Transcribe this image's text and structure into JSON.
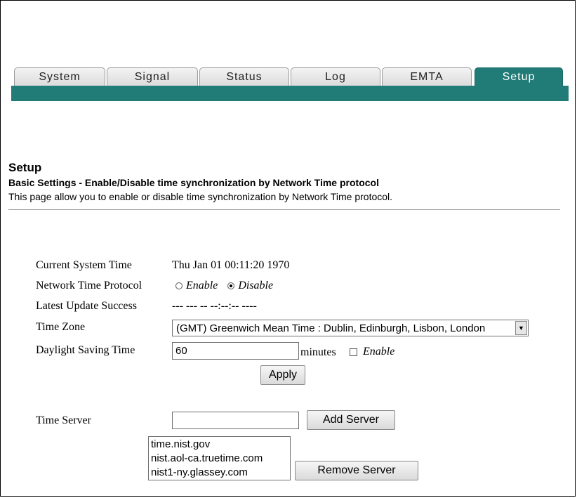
{
  "tabs": [
    {
      "label": "System",
      "active": false
    },
    {
      "label": "Signal",
      "active": false
    },
    {
      "label": "Status",
      "active": false
    },
    {
      "label": "Log",
      "active": false
    },
    {
      "label": "EMTA",
      "active": false
    },
    {
      "label": "Setup",
      "active": true
    }
  ],
  "colors": {
    "accent": "#217c78"
  },
  "header": {
    "title": "Setup",
    "subtitle": "Basic Settings - Enable/Disable time synchronization by Network Time protocol",
    "description": "This page allow you to enable or disable time synchronization by Network Time protocol."
  },
  "form": {
    "current_time_label": "Current System Time",
    "current_time_value": "Thu Jan 01 00:11:20 1970",
    "ntp_label": "Network Time Protocol",
    "ntp_enable_label": "Enable",
    "ntp_disable_label": "Disable",
    "ntp_selected": "Disable",
    "latest_update_label": "Latest Update Success",
    "latest_update_value": "--- --- -- --:--:-- ----",
    "timezone_label": "Time Zone",
    "timezone_value": "(GMT) Greenwich Mean Time : Dublin, Edinburgh, Lisbon, London",
    "dst_label": "Daylight Saving Time",
    "dst_value": "60",
    "dst_unit": "minutes",
    "dst_enable_label": "Enable",
    "dst_enabled": false,
    "apply_label": "Apply"
  },
  "time_server": {
    "label": "Time Server",
    "input_value": "",
    "add_label": "Add Server",
    "remove_label": "Remove Server",
    "servers": [
      "time.nist.gov",
      "nist.aol-ca.truetime.com",
      "nist1-ny.glassey.com"
    ]
  }
}
